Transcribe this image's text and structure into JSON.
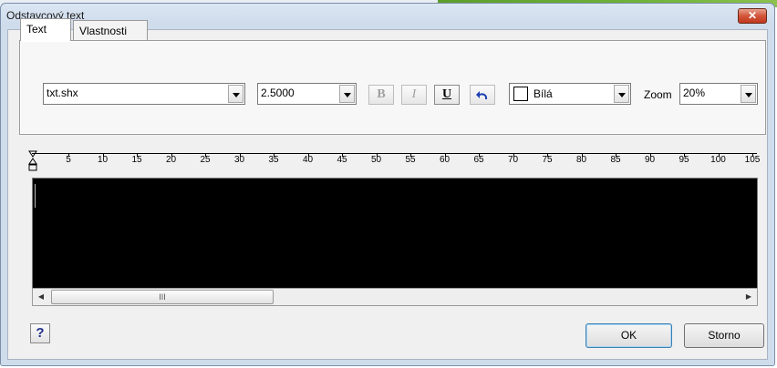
{
  "window": {
    "title": "Odstavcový text",
    "close_glyph": "✕"
  },
  "tabs": [
    {
      "label": "Text",
      "active": true
    },
    {
      "label": "Vlastnosti",
      "active": false
    }
  ],
  "toolbar": {
    "font": {
      "value": "txt.shx"
    },
    "size": {
      "value": "2.5000"
    },
    "bold_label": "B",
    "italic_label": "I",
    "underline_label": "U",
    "undo_icon": "undo-icon",
    "color": {
      "value": "Bílá",
      "swatch": "#ffffff"
    },
    "zoom": {
      "label": "Zoom",
      "value": "20%"
    }
  },
  "ruler": {
    "labels": [
      "5",
      "10",
      "15",
      "20",
      "25",
      "30",
      "35",
      "40",
      "45",
      "50",
      "55",
      "60",
      "65",
      "70",
      "75",
      "80",
      "85",
      "90",
      "95",
      "100",
      "105"
    ]
  },
  "editor": {
    "background": "#000000",
    "text": ""
  },
  "scrollbar": {
    "thumb_grip": "III",
    "left_arrow": "◀",
    "right_arrow": "▶"
  },
  "footer": {
    "help_label": "?",
    "ok_label": "OK",
    "cancel_label": "Storno"
  },
  "colors": {
    "accent": "#3c7fb1",
    "close": "#c2381e"
  }
}
